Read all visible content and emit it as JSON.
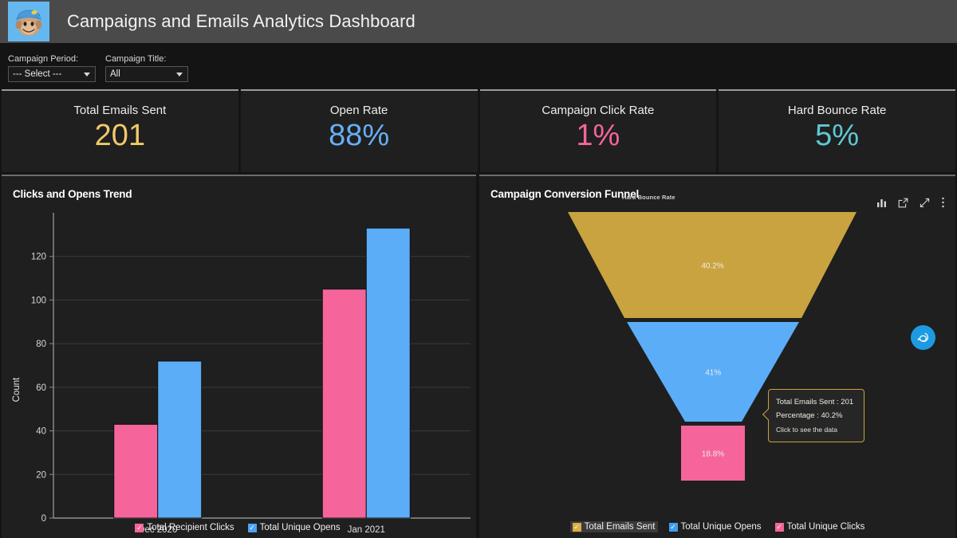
{
  "header": {
    "title": "Campaigns and Emails Analytics Dashboard",
    "logo_icon": "mailchimp-freddie-logo"
  },
  "filters": [
    {
      "label": "Campaign Period:",
      "value": "--- Select ---",
      "icon": "chevron-down-icon"
    },
    {
      "label": "Campaign Title:",
      "value": "All",
      "icon": "chevron-down-icon"
    }
  ],
  "kpis": [
    {
      "title": "Total Emails Sent",
      "value": "201",
      "color": "#f0c96a"
    },
    {
      "title": "Open Rate",
      "value": "88%",
      "color": "#67aef5"
    },
    {
      "title": "Campaign Click Rate",
      "value": "1%",
      "color": "#f5659b"
    },
    {
      "title": "Hard Bounce Rate",
      "value": "5%",
      "color": "#5fc8d2"
    }
  ],
  "bar_panel": {
    "title": "Clicks and Opens Trend"
  },
  "funnel_panel": {
    "title": "Campaign Conversion Funnel",
    "subtitle": "Hard Bounce Rate",
    "icons": [
      "bar-chart-icon",
      "open-in-new-icon",
      "expand-icon",
      "more-vertical-icon"
    ],
    "legend": [
      {
        "label": "Total Emails Sent",
        "color": "#d9ae42",
        "checked": true,
        "active": true
      },
      {
        "label": "Total Unique Opens",
        "color": "#3f9ef0",
        "checked": true,
        "active": false
      },
      {
        "label": "Total Unique Clicks",
        "color": "#f5659b",
        "checked": true,
        "active": false
      }
    ],
    "tooltip": {
      "line1": "Total Emails Sent : 201",
      "line2": "Percentage : 40.2%",
      "hint": "Click to see the data"
    }
  },
  "chat_fab": {
    "icon": "chat-bubble-icon",
    "color": "#1e9ae0"
  },
  "chart_data": [
    {
      "type": "bar",
      "title": "Clicks and Opens Trend",
      "categories": [
        "Dec 2020",
        "Jan 2021"
      ],
      "series": [
        {
          "name": "Total Recipient Clicks",
          "color": "#f5659b",
          "values": [
            43,
            105
          ]
        },
        {
          "name": "Total Unique Opens",
          "color": "#5cadf8",
          "values": [
            72,
            133
          ]
        }
      ],
      "xlabel": "",
      "ylabel": "Count",
      "ylim": [
        0,
        140
      ],
      "yticks": [
        0,
        20,
        40,
        60,
        80,
        100,
        120
      ],
      "grid": true,
      "legend_position": "bottom",
      "legend": [
        {
          "label": "Total Recipient Clicks",
          "color": "#f5659b",
          "checked": true
        },
        {
          "label": "Total Unique Opens",
          "color": "#4da3f5",
          "checked": true
        }
      ]
    },
    {
      "type": "funnel",
      "title": "Campaign Conversion Funnel",
      "subtitle": "Hard Bounce Rate",
      "stages": [
        {
          "name": "Total Emails Sent",
          "label": "40.2%",
          "value": 201,
          "percentage": 40.2,
          "color": "#c9a33f"
        },
        {
          "name": "Total Unique Opens",
          "label": "41%",
          "percentage": 41,
          "color": "#5cadf8"
        },
        {
          "name": "Total Unique Clicks",
          "label": "18.8%",
          "percentage": 18.8,
          "color": "#f5659b"
        }
      ],
      "legend_position": "bottom"
    }
  ]
}
